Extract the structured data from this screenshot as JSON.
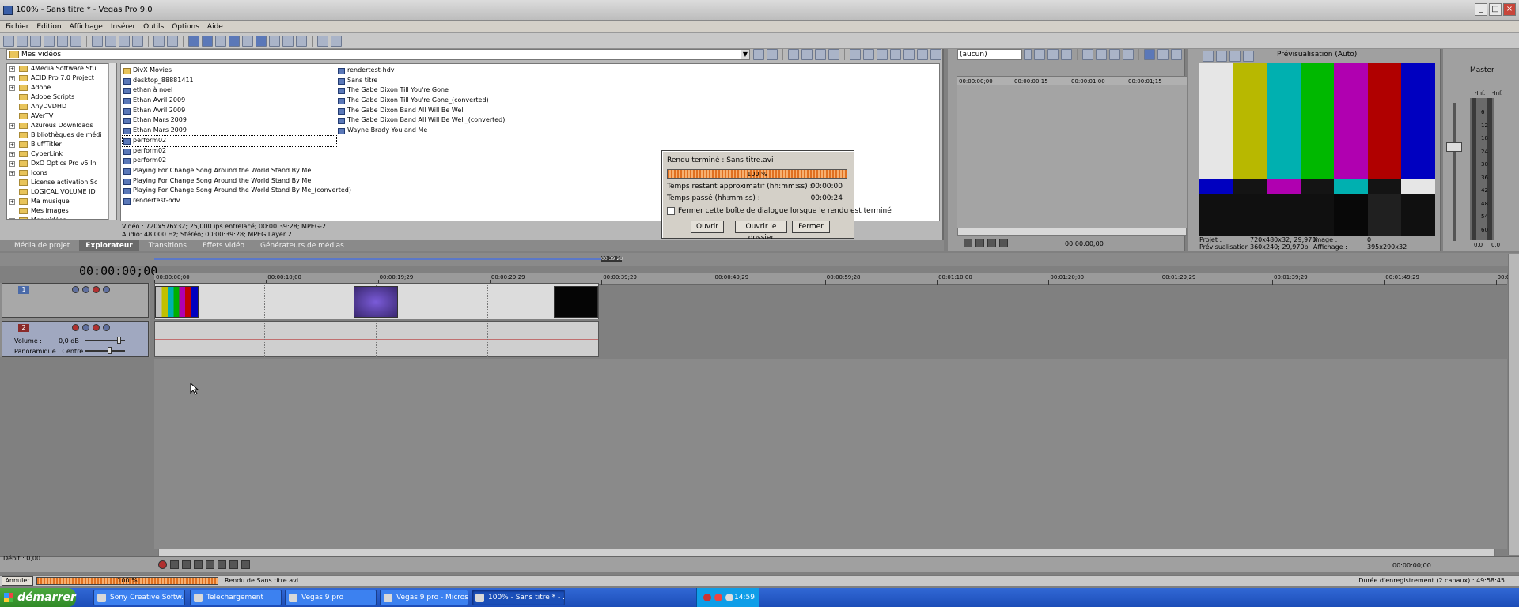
{
  "window": {
    "title": "100% - Sans titre * - Vegas Pro 9.0",
    "controls": [
      "_",
      "□",
      "×"
    ]
  },
  "menu": [
    "Fichier",
    "Edition",
    "Affichage",
    "Insérer",
    "Outils",
    "Options",
    "Aide"
  ],
  "explorer": {
    "path": "Mes vidéos",
    "tree": [
      {
        "label": "4Media Software Stu",
        "expand": "+"
      },
      {
        "label": "ACID Pro 7.0 Project",
        "expand": "+"
      },
      {
        "label": "Adobe",
        "expand": "+"
      },
      {
        "label": "Adobe Scripts",
        "expand": ""
      },
      {
        "label": "AnyDVDHD",
        "expand": ""
      },
      {
        "label": "AVerTV",
        "expand": ""
      },
      {
        "label": "Azureus Downloads",
        "expand": "+"
      },
      {
        "label": "Bibliothèques de médi",
        "expand": ""
      },
      {
        "label": "BluffTitler",
        "expand": "+"
      },
      {
        "label": "CyberLink",
        "expand": "+"
      },
      {
        "label": "DxO Optics Pro v5 In",
        "expand": "+"
      },
      {
        "label": "Icons",
        "expand": "+"
      },
      {
        "label": "License activation Sc",
        "expand": ""
      },
      {
        "label": "LOGICAL VOLUME ID",
        "expand": ""
      },
      {
        "label": "Ma musique",
        "expand": "+"
      },
      {
        "label": "Mes images",
        "expand": ""
      },
      {
        "label": "Mes vidéos",
        "expand": "+"
      }
    ],
    "files_col1": [
      {
        "label": "DivX Movies",
        "kind": "dir"
      },
      {
        "label": "desktop_88881411",
        "kind": "med"
      },
      {
        "label": "ethan à noel",
        "kind": "med"
      },
      {
        "label": "Ethan Avril 2009",
        "kind": "med"
      },
      {
        "label": "Ethan Avril 2009",
        "kind": "med"
      },
      {
        "label": "Ethan Mars 2009",
        "kind": "med"
      },
      {
        "label": "Ethan Mars 2009",
        "kind": "med"
      },
      {
        "label": "perform02",
        "kind": "med",
        "selected": true
      },
      {
        "label": "perform02",
        "kind": "med"
      },
      {
        "label": "perform02",
        "kind": "med"
      },
      {
        "label": "Playing For Change Song Around the World  Stand By Me",
        "kind": "med"
      },
      {
        "label": "Playing For Change Song Around the World  Stand By Me",
        "kind": "med"
      },
      {
        "label": "Playing For Change Song Around the World  Stand By Me_(converted)",
        "kind": "med"
      },
      {
        "label": "rendertest-hdv",
        "kind": "med"
      }
    ],
    "files_col2": [
      {
        "label": "rendertest-hdv",
        "kind": "med"
      },
      {
        "label": "Sans titre",
        "kind": "med"
      },
      {
        "label": "The Gabe Dixon  Till You're Gone",
        "kind": "med"
      },
      {
        "label": "The Gabe Dixon  Till You're Gone_(converted)",
        "kind": "med"
      },
      {
        "label": "The Gabe Dixon Band  All Will Be Well",
        "kind": "med"
      },
      {
        "label": "The Gabe Dixon Band  All Will Be Well_(converted)",
        "kind": "med"
      },
      {
        "label": "Wayne Brady  You and Me",
        "kind": "med"
      }
    ],
    "info_line1": "Vidéo : 720x576x32; 25,000 ips entrelacé; 00:00:39:28; MPEG-2",
    "info_line2": "Audio: 48 000 Hz; Stéréo; 00:00:39:28; MPEG Layer 2"
  },
  "tabs": [
    {
      "label": "Média de projet",
      "active": false
    },
    {
      "label": "Explorateur",
      "active": true
    },
    {
      "label": "Transitions",
      "active": false
    },
    {
      "label": "Effets vidéo",
      "active": false
    },
    {
      "label": "Générateurs de médias",
      "active": false
    }
  ],
  "dialog": {
    "title": "Rendu terminé : Sans titre.avi",
    "progress_label": "100 %",
    "progress": 100,
    "remaining_label": "Temps restant approximatif (hh:mm:ss) :",
    "remaining_value": "00:00:00",
    "elapsed_label": "Temps passé (hh:mm:ss) :",
    "elapsed_value": "00:00:24",
    "checkbox_label": "Fermer cette boîte de dialogue lorsque le rendu est terminé",
    "btn_open": "Ouvrir",
    "btn_open_folder": "Ouvrir le dossier",
    "btn_close": "Fermer"
  },
  "trimmer": {
    "select_value": "(aucun)",
    "ruler": [
      "00:00:00;00",
      "00:00:00;15",
      "00:00:01;00",
      "00:00:01;15"
    ],
    "time": "00:00:00;00"
  },
  "preview": {
    "mode": "Prévisualisation (Auto)",
    "project_label": "Projet :",
    "project_value": "720x480x32; 29,970i",
    "image_label": "Image :",
    "image_value": "0",
    "previz_label": "Prévisualisation :",
    "previz_value": "360x240; 29,970p",
    "display_label": "Affichage :",
    "display_value": "395x290x32",
    "colors": {
      "top": [
        "#e6e6e6",
        "#b8b800",
        "#00b0b0",
        "#00b800",
        "#b000b0",
        "#b00000",
        "#0000c0"
      ],
      "mid": [
        "#0000c0",
        "#141414",
        "#b000b0",
        "#141414",
        "#00b0b0",
        "#141414",
        "#e6e6e6"
      ],
      "bot": [
        "#101010",
        "#101010",
        "#101010",
        "#101010",
        "#080808",
        "#202020",
        "#101010"
      ]
    }
  },
  "mixer": {
    "title": "Master",
    "inf_left": "-Inf.",
    "inf_right": "-Inf.",
    "scale": [
      "6",
      "12",
      "18",
      "24",
      "30",
      "36",
      "42",
      "48",
      "54",
      "60"
    ],
    "bottom_left": "0.0",
    "bottom_right": "0.0"
  },
  "timeline": {
    "timecode": "00:00:00;00",
    "marker": "00:39:28",
    "ruler": [
      "00:00:00;00",
      "00:00:10;00",
      "00:00:19;29",
      "00:00:29;29",
      "00:00:39;29",
      "00:00:49;29",
      "00:00:59;28",
      "00:01:10;00",
      "00:01:20;00",
      "00:01:29;29",
      "00:01:39;29",
      "00:01:49;29",
      "00:0"
    ],
    "track1_number": "1",
    "track2_number": "2",
    "volume_label": "Volume :",
    "volume_value": "0,0 dB",
    "pan_label": "Panoramique : Centre",
    "rate": "Débit : 0,00",
    "timecode2": "00:00:00;00"
  },
  "status": {
    "cancel": "Annuler",
    "progress_label": "100 %",
    "progress": 100,
    "message": "Rendu de Sans titre.avi",
    "record_duration": "Durée d'enregistrement (2 canaux) : 49:58:45"
  },
  "taskbar": {
    "start": "démarrer",
    "tasks": [
      {
        "label": "Sony Creative Softw...",
        "active": false
      },
      {
        "label": "Telechargement",
        "active": false
      },
      {
        "label": "Vegas 9 pro",
        "active": false
      },
      {
        "label": "Vegas 9 pro - Micros...",
        "active": false
      },
      {
        "label": "100% - Sans titre * - ...",
        "active": true
      }
    ],
    "clock": "14:59"
  }
}
